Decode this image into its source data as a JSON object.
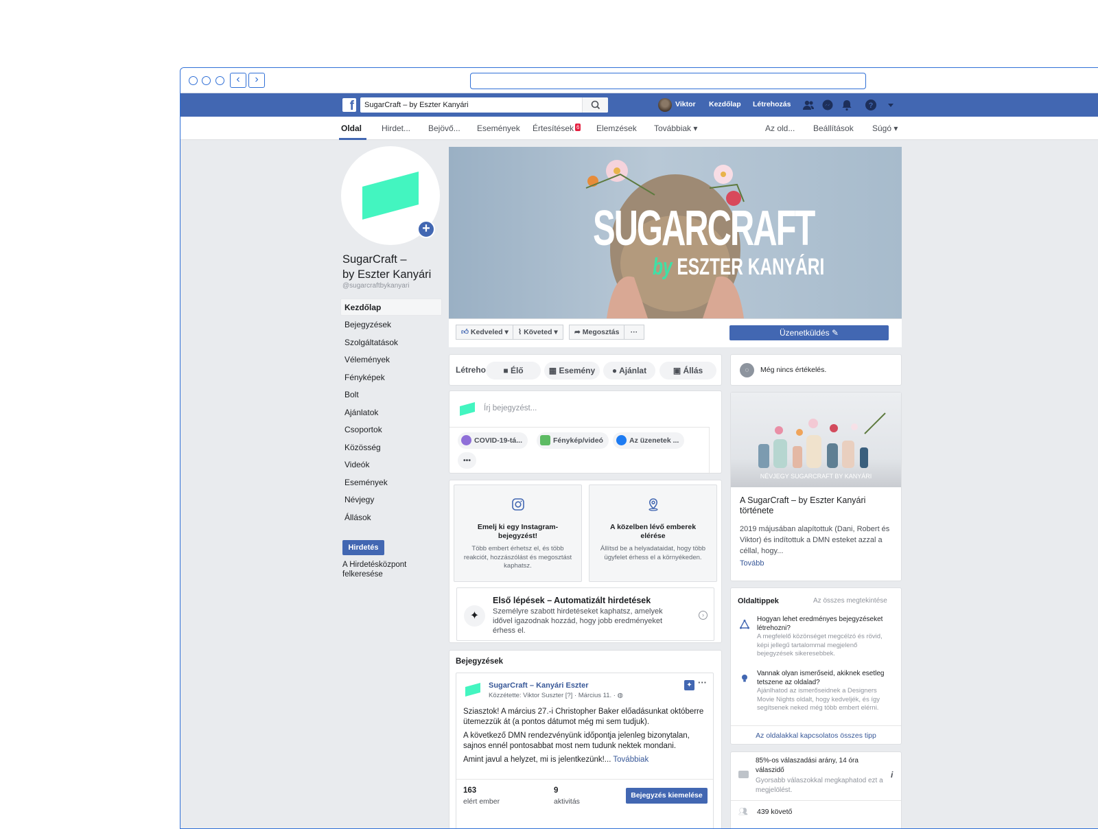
{
  "navbar": {
    "search_value": "SugarCraft – by Eszter Kanyári",
    "user_name": "Viktor",
    "home": "Kezdőlap",
    "create": "Létrehozás"
  },
  "page_tabs": {
    "items": [
      "Oldal",
      "Hirdet...",
      "Bejövő...",
      "Események",
      "Értesítések",
      "Elemzések",
      "Továbbiak ▾",
      "Az old...",
      "Beállítások",
      "Súgó ▾"
    ],
    "notifications_badge": "6"
  },
  "profile": {
    "name_line1": "SugarCraft –",
    "name_line2": "by Eszter Kanyári",
    "handle": "@sugarcraftbykanyari"
  },
  "sidebar": {
    "items": [
      "Kezdőlap",
      "Bejegyzések",
      "Szolgáltatások",
      "Vélemények",
      "Fényképek",
      "Bolt",
      "Ajánlatok",
      "Csoportok",
      "Közösség",
      "Videók",
      "Események",
      "Névjegy",
      "Állások"
    ],
    "ad_button": "Hirdetés",
    "ad_center": "A Hirdetésközpont felkeresése"
  },
  "cover": {
    "title": "SUGARCRAFT",
    "by_prefix": "by",
    "by_name": "ESZTER KANYÁRI"
  },
  "actions": {
    "like": "Kedveled",
    "follow": "Követed",
    "share": "Megosztás",
    "more": "···",
    "message": "Üzenetküldés"
  },
  "create_bar": {
    "label": "Létreho",
    "live": "Élő",
    "event": "Esemény",
    "offer": "Ajánlat",
    "job": "Állás"
  },
  "composer": {
    "placeholder": "Írj bejegyzést...",
    "covid": "COVID-19-tá...",
    "photo": "Fénykép/videó",
    "messages": "Az üzenetek ...",
    "more": "•••"
  },
  "promos": [
    {
      "title": "Emelj ki egy Instagram-bejegyzést!",
      "desc": "Több embert érhetsz el, és több reakciót, hozzászólást és megosztást kaphatsz."
    },
    {
      "title": "A közelben lévő emberek elérése",
      "desc": "Állítsd be a helyadataidat, hogy több ügyfelet érhess el a környékeden."
    }
  ],
  "auto_ads": {
    "title": "Első lépések – Automatizált hirdetések",
    "desc": "Személyre szabott hirdetéseket kaphatsz, amelyek idővel igazodnak hozzád, hogy jobb eredményeket érhess el."
  },
  "posts": {
    "header": "Bejegyzések",
    "author": "SugarCraft – Kanyári Eszter",
    "meta": "Közzétette: Viktor Suszter [?] · Március 11. ·",
    "p1": "Sziasztok! A március 27.-i Christopher Baker előadásunkat októberre ütemezzük át (a pontos dátumot még mi sem tudjuk).",
    "p2": "A következő DMN rendezvényünk időpontja jelenleg bizonytalan, sajnos ennél pontosabbat most nem tudunk nektek mondani.",
    "p3": "Amint javul a helyzet, mi is jelentkezünk!...",
    "more_link": "Továbbiak",
    "reach_value": "163",
    "reach_label": "elért ember",
    "activity_value": "9",
    "activity_label": "aktivitás",
    "boost": "Bejegyzés kiemelése"
  },
  "right": {
    "no_reviews": "Még nincs értékelés.",
    "photo_caption": "NÉVJEGY SUGARCRAFT BY KANYÁRI",
    "story_title": "A SugarCraft – by Eszter Kanyári története",
    "story_body": "2019 májusában alapítottuk (Dani, Robert és Viktor) és indítottuk a DMN esteket azzal a céllal, hogy...",
    "story_more": "Tovább",
    "tips_title": "Oldaltippek",
    "tips_all": "Az összes megtekintése",
    "tip1_title": "Hogyan lehet eredményes bejegyzéseket létrehozni?",
    "tip1_desc": "A megfelelő közönséget megcélzó és rövid, képi jellegű tartalommal megjelenő bejegyzések sikeresebbek.",
    "tip2_title": "Vannak olyan ismerőseid, akiknek esetleg tetszene az oldalad?",
    "tip2_desc": "Ajánlhatod az ismerőseidnek a Designers Movie Nights oldalt, hogy kedveljék, és így segítsenek neked még több embert elérni.",
    "tips_footer": "Az oldalakkal kapcsolatos összes tipp",
    "response_title": "85%-os válaszadási arány, 14 óra válaszidő",
    "response_desc": "Gyorsabb válaszokkal megkaphatod ezt a megjelölést.",
    "followers": "439 követő"
  }
}
